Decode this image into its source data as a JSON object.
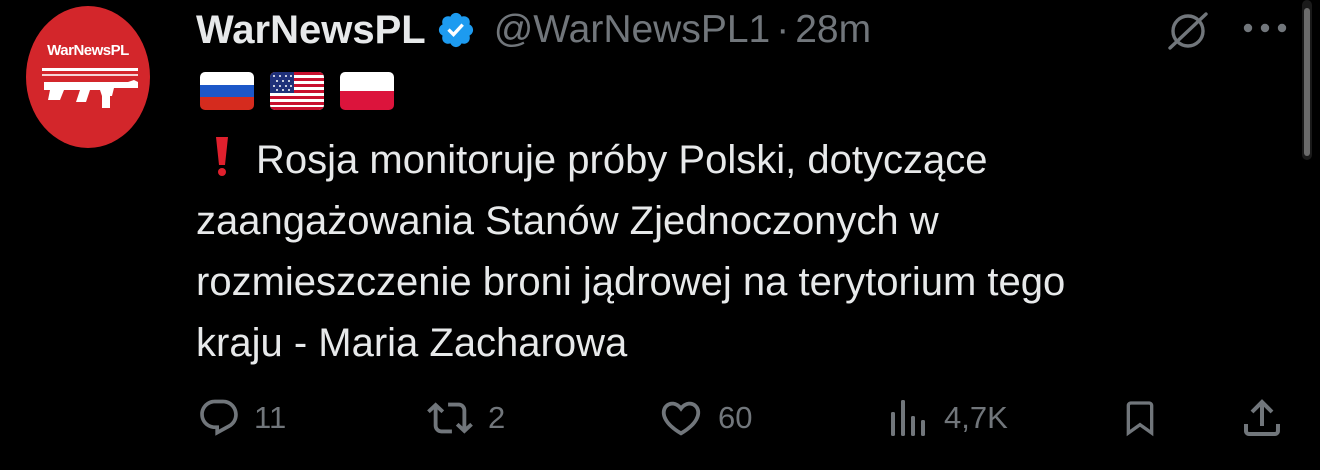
{
  "tweet": {
    "display_name": "WarNewsPL",
    "handle": "@WarNewsPL1",
    "separator": "·",
    "time": "28m",
    "avatar_text": "WarNewsPL",
    "flags": [
      "russia-flag",
      "usa-flag",
      "poland-flag"
    ],
    "text_lines": [
      "Rosja monitoruje próby Polski, dotyczące",
      "zaangażowania Stanów Zjednoczonych w",
      "rozmieszczenie broni jądrowej na terytorium tego",
      "kraju - Maria Zacharowa"
    ]
  },
  "actions": {
    "replies": "11",
    "reposts": "2",
    "likes": "60",
    "views": "4,7K"
  },
  "colors": {
    "background": "#000000",
    "text": "#e7e9ea",
    "secondary": "#71767b",
    "verified": "#1d9bf0",
    "avatar": "#d3262b",
    "exclamation": "#e0202d"
  },
  "icons": {
    "verified": "verified-badge-icon",
    "grok": "grok-icon",
    "more": "more-options-icon",
    "reply": "reply-icon",
    "repost": "repost-icon",
    "like": "heart-icon",
    "views": "views-icon",
    "bookmark": "bookmark-icon",
    "share": "share-icon"
  }
}
